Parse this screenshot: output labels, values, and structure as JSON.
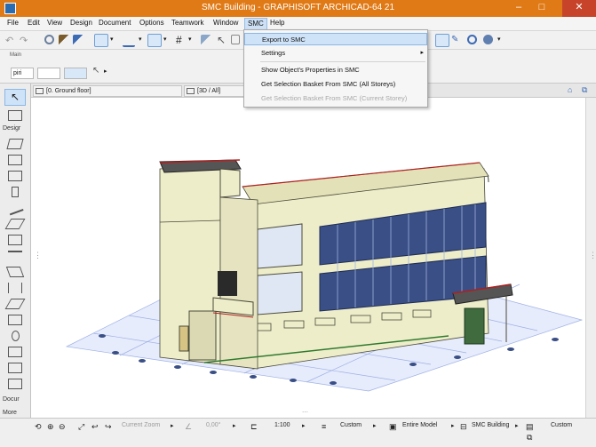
{
  "window": {
    "title": "SMC Building - GRAPHISOFT ARCHICAD-64 21",
    "minimize": "–",
    "maximize": "□",
    "close": "✕"
  },
  "menubar": {
    "items": [
      "File",
      "Edit",
      "View",
      "Design",
      "Document",
      "Options",
      "Teamwork",
      "Window",
      "SMC",
      "Help"
    ],
    "active": "SMC"
  },
  "smc_menu": {
    "items": [
      {
        "label": "Export to SMC",
        "state": "highlight"
      },
      {
        "label": "Settings",
        "state": "submenu"
      },
      {
        "label": "Show Object's Properties in SMC",
        "state": "normal"
      },
      {
        "label": "Get Selection Basket From SMC (All Storeys)",
        "state": "normal"
      },
      {
        "label": "Get Selection Basket From SMC (Current Storey)",
        "state": "disabled"
      }
    ],
    "submenu_arrow": "▸"
  },
  "toolbar2": {
    "palette_label": "Main",
    "fields": [
      "piri",
      "",
      ""
    ]
  },
  "toolbox": {
    "design_label": "Desigr",
    "document_label": "Docur",
    "more_label": "More"
  },
  "tabs": [
    {
      "label": "[0. Ground floor]"
    },
    {
      "label": "[3D / All]"
    }
  ],
  "statusbar": {
    "zoom_label": "Current Zoom",
    "angle": "0,00°",
    "scale": "1:100",
    "layer_combo": "Custom",
    "model_view": "Entire Model",
    "renovation": "SMC Building",
    "pen_set": "Custom"
  },
  "colors": {
    "titlebar": "#e07a16",
    "menu_highlight": "#cfe3f8",
    "building_wall": "#eeedca",
    "glass": "#3a4f86",
    "roof_edge": "#b02020",
    "ground_grid": "#9fb0e6"
  }
}
